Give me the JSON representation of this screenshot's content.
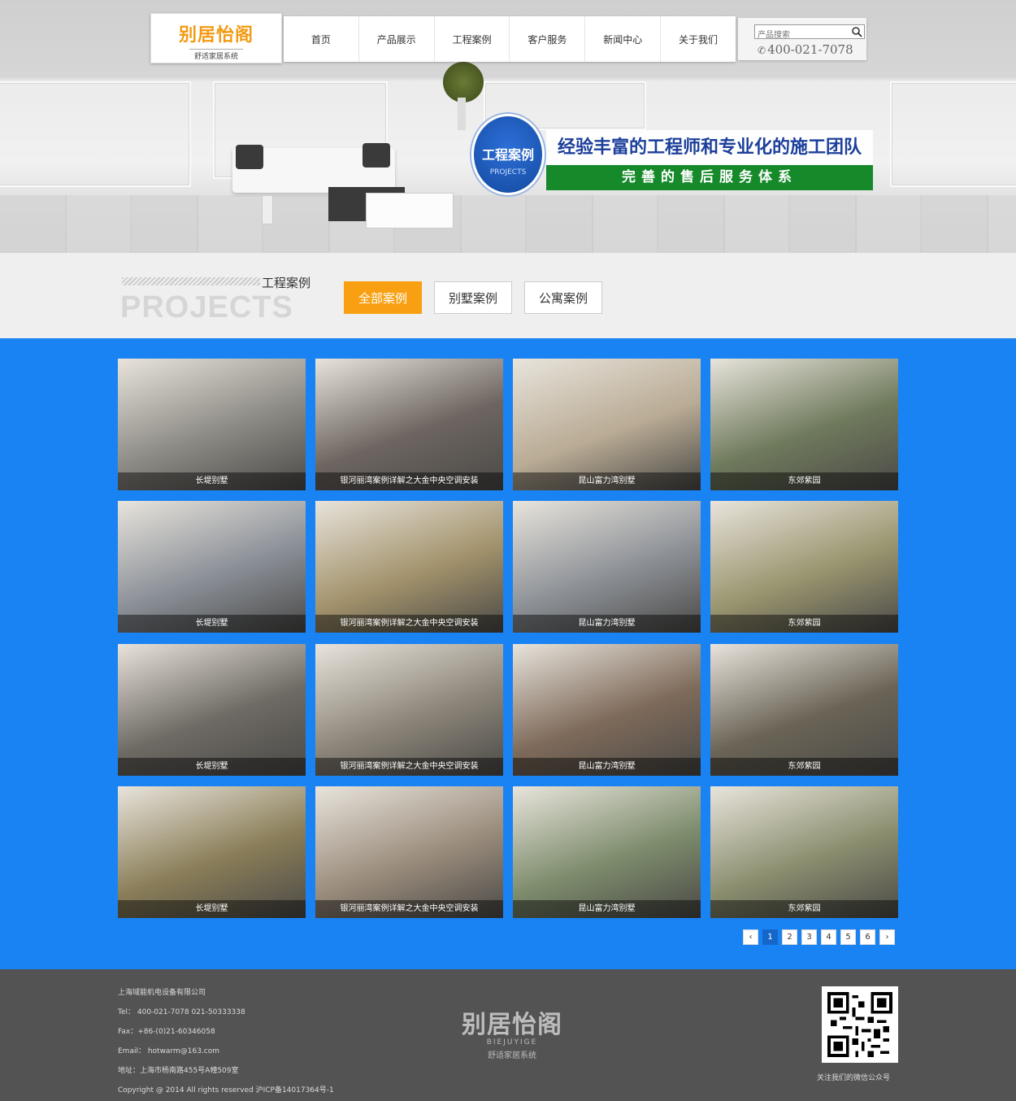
{
  "header": {
    "logo_text": "别居怡阁",
    "logo_en": "BIEJUYIGE",
    "logo_sub": "舒适家居系统",
    "nav": [
      {
        "label": "首页"
      },
      {
        "label": "产品展示"
      },
      {
        "label": "工程案例"
      },
      {
        "label": "客户服务"
      },
      {
        "label": "新闻中心"
      },
      {
        "label": "关于我们"
      }
    ],
    "search_placeholder": "产品搜索",
    "phone": "400-021-7078"
  },
  "banner": {
    "circle_title": "工程案例",
    "circle_sub": "PROJECTS",
    "headline": "经验丰富的工程师和专业化的施工团队",
    "subline": "完善的售后服务体系"
  },
  "section": {
    "title_cn": "工程案例",
    "title_en": "PROJECTS",
    "filters": [
      {
        "label": "全部案例",
        "active": true
      },
      {
        "label": "别墅案例",
        "active": false
      },
      {
        "label": "公寓案例",
        "active": false
      }
    ]
  },
  "projects": [
    {
      "caption": "长堤别墅",
      "color": "#8c8a84"
    },
    {
      "caption": "银河丽湾案例详解之大金中央空调安装",
      "color": "#6d6560"
    },
    {
      "caption": "昆山富力湾别墅",
      "color": "#b9ab94"
    },
    {
      "caption": "东郊紫园",
      "color": "#6f7a5c"
    },
    {
      "caption": "长堤别墅",
      "color": "#8a8f97"
    },
    {
      "caption": "银河丽湾案例详解之大金中央空调安装",
      "color": "#a2926b"
    },
    {
      "caption": "昆山富力湾别墅",
      "color": "#8c9096"
    },
    {
      "caption": "东郊紫园",
      "color": "#99956f"
    },
    {
      "caption": "长堤别墅",
      "color": "#6e6a64"
    },
    {
      "caption": "银河丽湾案例详解之大金中央空调安装",
      "color": "#8c8579"
    },
    {
      "caption": "昆山富力湾别墅",
      "color": "#7e6a5a"
    },
    {
      "caption": "东郊紫园",
      "color": "#6a6456"
    },
    {
      "caption": "长堤别墅",
      "color": "#8a7e58"
    },
    {
      "caption": "银河丽湾案例详解之大金中央空调安装",
      "color": "#9a8c7c"
    },
    {
      "caption": "昆山富力湾别墅",
      "color": "#7d8c6c"
    },
    {
      "caption": "东郊紫园",
      "color": "#8a8e6e"
    }
  ],
  "pagination": {
    "prev": "‹",
    "next": "›",
    "pages": [
      "1",
      "2",
      "3",
      "4",
      "5",
      "6"
    ],
    "current": "1"
  },
  "footer": {
    "company": "上海域能机电设备有限公司",
    "tel": "Tel： 400-021-7078  021-50333338",
    "fax": "Fax：+86-(0)21-60346058",
    "email": "Email： hotwarm@163.com",
    "address": "地址：上海市杨南路455号A幢509室",
    "copyright": "Copyright @ 2014 All rights reserved 沪ICP备14017364号-1",
    "qr_label": "关注我们的微信公众号",
    "logo_text": "别居怡阁",
    "logo_en": "BIEJUYIGE",
    "logo_sub": "舒适家居系统"
  },
  "colors": {
    "accent_orange": "#f9a012",
    "section_blue": "#1a83f3",
    "banner_green": "#168a2a",
    "footer_bg": "#535353"
  },
  "icons": {
    "search": "search-icon",
    "phone": "phone-icon",
    "prev": "chevron-left-icon",
    "next": "chevron-right-icon"
  }
}
